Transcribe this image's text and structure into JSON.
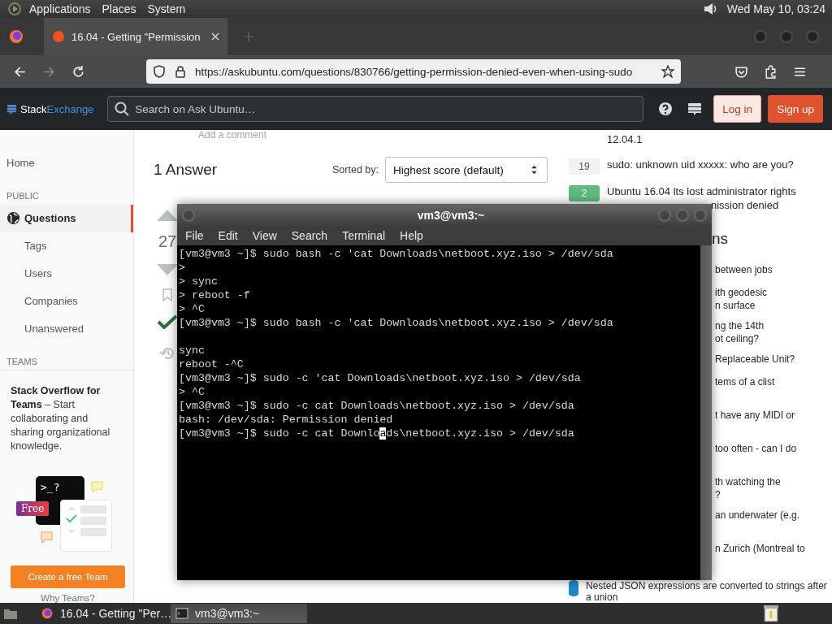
{
  "desktop_panel": {
    "menus": [
      "Applications",
      "Places",
      "System"
    ],
    "clock": "Wed May 10, 03:24"
  },
  "browser": {
    "tab": {
      "title": "16.04 - Getting \"Permission",
      "selected": true
    },
    "url": "https://askubuntu.com/questions/830766/getting-permission-denied-even-when-using-sudo"
  },
  "site_header": {
    "logo": {
      "first": "Stack",
      "second": "Exchange"
    },
    "search": {
      "placeholder": "Search on Ask Ubuntu…"
    },
    "buttons": [
      {
        "label": "Log in",
        "kind": "secondary"
      },
      {
        "label": "Sign up",
        "kind": "primary"
      }
    ]
  },
  "sidebar": {
    "items": [
      {
        "label": "Home",
        "kind": "link",
        "selected": false
      },
      {
        "label": "PUBLIC",
        "kind": "heading"
      },
      {
        "label": "Questions",
        "kind": "primary",
        "selected": true
      },
      {
        "label": "Tags",
        "kind": "sub",
        "selected": false
      },
      {
        "label": "Users",
        "kind": "sub",
        "selected": false
      },
      {
        "label": "Companies",
        "kind": "sub",
        "selected": false
      },
      {
        "label": "Unanswered",
        "kind": "sub",
        "selected": false
      },
      {
        "label": "TEAMS",
        "kind": "heading"
      }
    ],
    "teams_card": {
      "text": "**Stack Overflow for Teams** – Start collaborating and sharing organizational knowledge.",
      "prompt": ">_?",
      "badge": "Free",
      "button": "Create a free Team",
      "link": "Why Teams?"
    }
  },
  "answers": {
    "comment_link": "Add a comment",
    "count": "1 Answer",
    "sort_label": "Sorted by:",
    "sort_value": "Highest score (default)",
    "vote_count": "27",
    "accepted": true
  },
  "terminal": {
    "title": "vm3@vm3:~",
    "menus": [
      "File",
      "Edit",
      "View",
      "Search",
      "Terminal",
      "Help"
    ],
    "lines": [
      {
        "kind": "text",
        "text": "[vm3@vm3 ~]$ sudo bash -c 'cat Downloads\\netboot.xyz.iso > /dev/sda"
      },
      {
        "kind": "text",
        "text": ">"
      },
      {
        "kind": "text",
        "text": "> sync"
      },
      {
        "kind": "text",
        "text": "> reboot -f"
      },
      {
        "kind": "text",
        "text": "> ^C"
      },
      {
        "kind": "text",
        "text": "[vm3@vm3 ~]$ sudo bash -c 'cat Downloads\\netboot.xyz.iso > /dev/sda"
      },
      {
        "kind": "blank"
      },
      {
        "kind": "text",
        "text": "sync"
      },
      {
        "kind": "text",
        "text": "reboot -^C"
      },
      {
        "kind": "text",
        "text": "[vm3@vm3 ~]$ sudo -c 'cat Downloads\\netboot.xyz.iso > /dev/sda"
      },
      {
        "kind": "text",
        "text": "> ^C"
      },
      {
        "kind": "text",
        "text": "[vm3@vm3 ~]$ sudo -c cat Downloads\\netboot.xyz.iso > /dev/sda"
      },
      {
        "kind": "text",
        "text": "bash: /dev/sda: Permission denied"
      },
      {
        "kind": "cursor",
        "before": "[vm3@vm3 ~]$ sudo -c cat Downlo",
        "cursor": "a",
        "after": "ds\\netboot.xyz.iso > /dev/sda"
      }
    ]
  },
  "related": [
    {
      "kind": "cut",
      "title": "12.04.1"
    },
    {
      "kind": "full",
      "score": "19",
      "answered": false,
      "title": "sudo: unknown uid xxxxx: who are you?"
    },
    {
      "kind": "full",
      "score": "2",
      "answered": true,
      "title": "Ubuntu 16.04 lts lost administrator rights",
      "tail": "nission denied"
    }
  ],
  "hot_questions": {
    "heading": "ns",
    "items": [
      {
        "kind": "single",
        "lines": [
          "between jobs"
        ]
      },
      {
        "kind": "double",
        "lines": [
          "ith geodesic",
          "n surface"
        ]
      },
      {
        "kind": "double",
        "lines": [
          "ng the 14th",
          "ot ceiling?"
        ]
      },
      {
        "kind": "single",
        "lines": [
          "Replaceable Unit?"
        ]
      },
      {
        "kind": "double",
        "lines": [
          "tems of a clist"
        ]
      },
      {
        "kind": "double",
        "lines": [
          "t have any MIDI or"
        ]
      },
      {
        "kind": "double",
        "lines": [
          "too often - can I do"
        ]
      },
      {
        "kind": "double",
        "lines": [
          "th watching the",
          "?"
        ]
      },
      {
        "kind": "double",
        "lines": [
          "an underwater (e.g."
        ]
      },
      {
        "kind": "double",
        "lines": [
          "n Zurich (Montreal to"
        ]
      }
    ],
    "last": "Nested JSON expressions are converted to strings after a union"
  },
  "taskbar": {
    "tasks": [
      {
        "kind": "browser",
        "title": "16.04 - Getting \"Per…",
        "selected": false
      },
      {
        "kind": "terminal",
        "title": "vm3@vm3:~",
        "selected": true
      }
    ]
  }
}
